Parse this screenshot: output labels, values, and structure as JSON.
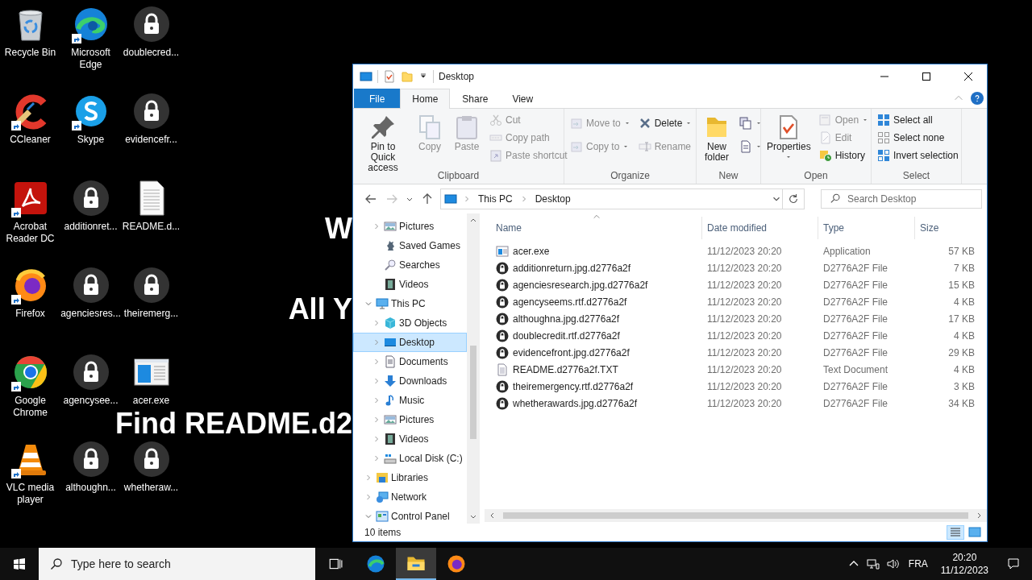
{
  "desktop": {
    "wallpaper_text": [
      "W",
      "All Y",
      "Find README.d2"
    ],
    "icons": [
      {
        "label": "Recycle Bin",
        "kind": "recycle",
        "shortcut": false
      },
      {
        "label": "CCleaner",
        "kind": "ccleaner",
        "shortcut": true
      },
      {
        "label": "Acrobat Reader DC",
        "kind": "acrobat",
        "shortcut": true
      },
      {
        "label": "Firefox",
        "kind": "firefox",
        "shortcut": true
      },
      {
        "label": "Google Chrome",
        "kind": "chrome",
        "shortcut": true
      },
      {
        "label": "VLC media player",
        "kind": "vlc",
        "shortcut": true
      },
      {
        "label": "Microsoft Edge",
        "kind": "edge",
        "shortcut": true
      },
      {
        "label": "Skype",
        "kind": "skype",
        "shortcut": true
      },
      {
        "label": "additionret...",
        "kind": "locked",
        "shortcut": false
      },
      {
        "label": "agenciesres...",
        "kind": "locked",
        "shortcut": false
      },
      {
        "label": "agencysee...",
        "kind": "locked",
        "shortcut": false
      },
      {
        "label": "althoughn...",
        "kind": "locked",
        "shortcut": false
      },
      {
        "label": "doublecred...",
        "kind": "locked",
        "shortcut": false
      },
      {
        "label": "evidencefr...",
        "kind": "locked",
        "shortcut": false
      },
      {
        "label": "README.d...",
        "kind": "document",
        "shortcut": false
      },
      {
        "label": "theiremerg...",
        "kind": "locked",
        "shortcut": false
      },
      {
        "label": "acer.exe",
        "kind": "exe",
        "shortcut": false
      },
      {
        "label": "whetheraw...",
        "kind": "locked",
        "shortcut": false
      }
    ]
  },
  "explorer": {
    "title": "Desktop",
    "tabs": [
      {
        "label": "File",
        "kind": "file",
        "selected": false
      },
      {
        "label": "Home",
        "kind": "tab",
        "selected": true
      },
      {
        "label": "Share",
        "kind": "tab",
        "selected": false
      },
      {
        "label": "View",
        "kind": "tab",
        "selected": false
      }
    ],
    "ribbon": {
      "groups": [
        {
          "label": "Clipboard",
          "items": [
            {
              "label": "Pin to Quick access",
              "kind": "pin",
              "disabled": false
            },
            {
              "label": "Copy",
              "kind": "copy",
              "disabled": true
            },
            {
              "label": "Paste",
              "kind": "paste",
              "disabled": true
            },
            {
              "label": "Cut",
              "kind": "cut",
              "disabled": true
            },
            {
              "label": "Copy path",
              "kind": "copy-path",
              "disabled": true
            },
            {
              "label": "Paste shortcut",
              "kind": "paste-shortcut",
              "disabled": true
            }
          ]
        },
        {
          "label": "Organize",
          "items": [
            {
              "label": "Move to",
              "kind": "move-to",
              "disabled": true,
              "dropdown": true
            },
            {
              "label": "Copy to",
              "kind": "copy-to",
              "disabled": true,
              "dropdown": true
            },
            {
              "label": "Delete",
              "kind": "delete",
              "disabled": false,
              "dropdown": true
            },
            {
              "label": "Rename",
              "kind": "rename",
              "disabled": true,
              "dropdown": false
            }
          ]
        },
        {
          "label": "New",
          "items": [
            {
              "label": "New folder",
              "kind": "new-folder",
              "disabled": false
            },
            {
              "kind": "new-item",
              "disabled": false,
              "dropdown": true
            },
            {
              "kind": "easy-access",
              "disabled": false,
              "dropdown": true
            }
          ]
        },
        {
          "label": "Open",
          "items": [
            {
              "label": "Properties",
              "kind": "properties",
              "disabled": false,
              "dropdown": true
            },
            {
              "label": "Open",
              "kind": "open",
              "disabled": true,
              "dropdown": true
            },
            {
              "label": "Edit",
              "kind": "edit",
              "disabled": true,
              "dropdown": false
            },
            {
              "label": "History",
              "kind": "history",
              "disabled": false,
              "dropdown": false
            }
          ]
        },
        {
          "label": "Select",
          "items": [
            {
              "label": "Select all",
              "kind": "select-all",
              "disabled": false
            },
            {
              "label": "Select none",
              "kind": "select-none",
              "disabled": false
            },
            {
              "label": "Invert selection",
              "kind": "invert-selection",
              "disabled": false
            }
          ]
        }
      ]
    },
    "address": {
      "crumbs": [
        "This PC",
        "Desktop"
      ],
      "search_placeholder": "Search Desktop"
    },
    "nav_pane": {
      "partial_children": [
        {
          "label": "Pictures",
          "kind": "pictures",
          "expandable": true,
          "expanded": false,
          "selected": false
        },
        {
          "label": "Saved Games",
          "kind": "games",
          "expandable": false,
          "selected": false
        },
        {
          "label": "Searches",
          "kind": "searches",
          "expandable": false,
          "selected": false
        },
        {
          "label": "Videos",
          "kind": "videos",
          "expandable": false,
          "selected": false
        }
      ],
      "items": [
        {
          "label": "This PC",
          "kind": "pc",
          "expandable": true,
          "expanded": true,
          "selected": false,
          "children": [
            {
              "label": "3D Objects",
              "kind": "cube",
              "expandable": true,
              "expanded": false,
              "selected": false
            },
            {
              "label": "Desktop",
              "kind": "desktop",
              "expandable": true,
              "expanded": false,
              "selected": true
            },
            {
              "label": "Documents",
              "kind": "documents",
              "expandable": true,
              "expanded": false,
              "selected": false
            },
            {
              "label": "Downloads",
              "kind": "downloads",
              "expandable": true,
              "expanded": false,
              "selected": false
            },
            {
              "label": "Music",
              "kind": "music",
              "expandable": true,
              "expanded": false,
              "selected": false
            },
            {
              "label": "Pictures",
              "kind": "pictures",
              "expandable": true,
              "expanded": false,
              "selected": false
            },
            {
              "label": "Videos",
              "kind": "videos",
              "expandable": true,
              "expanded": false,
              "selected": false
            },
            {
              "label": "Local Disk (C:)",
              "kind": "disk",
              "expandable": true,
              "expanded": false,
              "selected": false
            }
          ]
        },
        {
          "label": "Libraries",
          "kind": "libraries",
          "expandable": true,
          "expanded": false,
          "selected": false
        },
        {
          "label": "Network",
          "kind": "network",
          "expandable": true,
          "expanded": false,
          "selected": false
        },
        {
          "label": "Control Panel",
          "kind": "control",
          "expandable": true,
          "expanded": true,
          "selected": false
        }
      ]
    },
    "files": {
      "columns": [
        {
          "label": "Name",
          "sorted": true
        },
        {
          "label": "Date modified",
          "sorted": false
        },
        {
          "label": "Type",
          "sorted": false
        },
        {
          "label": "Size",
          "sorted": false
        }
      ],
      "rows": [
        {
          "kind": "exe",
          "name": "acer.exe",
          "date": "11/12/2023 20:20",
          "type": "Application",
          "size": "57 KB",
          "selected": false
        },
        {
          "kind": "locked",
          "name": "additionreturn.jpg.d2776a2f",
          "date": "11/12/2023 20:20",
          "type": "D2776A2F File",
          "size": "7 KB",
          "selected": false
        },
        {
          "kind": "locked",
          "name": "agenciesresearch.jpg.d2776a2f",
          "date": "11/12/2023 20:20",
          "type": "D2776A2F File",
          "size": "15 KB",
          "selected": false
        },
        {
          "kind": "locked",
          "name": "agencyseems.rtf.d2776a2f",
          "date": "11/12/2023 20:20",
          "type": "D2776A2F File",
          "size": "4 KB",
          "selected": false
        },
        {
          "kind": "locked",
          "name": "althoughna.jpg.d2776a2f",
          "date": "11/12/2023 20:20",
          "type": "D2776A2F File",
          "size": "17 KB",
          "selected": false
        },
        {
          "kind": "locked",
          "name": "doublecredit.rtf.d2776a2f",
          "date": "11/12/2023 20:20",
          "type": "D2776A2F File",
          "size": "4 KB",
          "selected": false
        },
        {
          "kind": "locked",
          "name": "evidencefront.jpg.d2776a2f",
          "date": "11/12/2023 20:20",
          "type": "D2776A2F File",
          "size": "29 KB",
          "selected": false
        },
        {
          "kind": "text",
          "name": "README.d2776a2f.TXT",
          "date": "11/12/2023 20:20",
          "type": "Text Document",
          "size": "4 KB",
          "selected": false
        },
        {
          "kind": "locked",
          "name": "theiremergency.rtf.d2776a2f",
          "date": "11/12/2023 20:20",
          "type": "D2776A2F File",
          "size": "3 KB",
          "selected": false
        },
        {
          "kind": "locked",
          "name": "whetherawards.jpg.d2776a2f",
          "date": "11/12/2023 20:20",
          "type": "D2776A2F File",
          "size": "34 KB",
          "selected": false
        }
      ]
    },
    "status": "10 items",
    "views": [
      {
        "kind": "details",
        "selected": true
      },
      {
        "kind": "large_icons",
        "selected": false
      }
    ]
  },
  "taskbar": {
    "search_placeholder": "Type here to search",
    "apps": [
      {
        "kind": "task_view",
        "active": false
      },
      {
        "kind": "edge",
        "active": false
      },
      {
        "kind": "explorer",
        "active": true
      },
      {
        "kind": "firefox",
        "active": false
      }
    ],
    "language": "FRA",
    "time": "20:20",
    "date": "11/12/2023"
  }
}
